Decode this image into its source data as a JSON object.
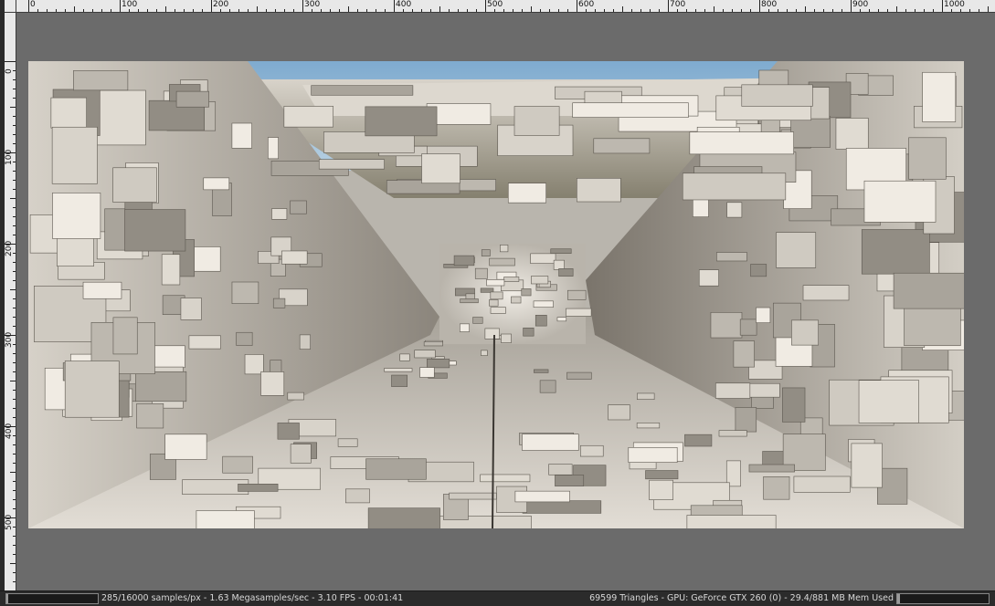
{
  "ruler": {
    "top_labels": [
      "0",
      "100",
      "200",
      "300",
      "400",
      "500",
      "600",
      "700",
      "800",
      "900",
      "1000"
    ],
    "left_labels": [
      "0",
      "100",
      "200",
      "300",
      "400",
      "500"
    ]
  },
  "status": {
    "left_text": "285/16000 samples/px - 1.63 Megasamples/sec - 3.10 FPS - 00:01:41",
    "right_text": "69599 Triangles - GPU: GeForce GTX 260 (0) - 29.4/881 MB Mem Used",
    "sample_progress": 0.0178,
    "memory_progress": 0.0334
  },
  "colors": {
    "sky": "#8fb6d4",
    "stone_light": "#d9d4cb",
    "stone_mid": "#b3aea5",
    "stone_dark": "#6f6a62",
    "background": "#6b6b6b"
  },
  "render": {
    "description_icon": "rendered-image"
  }
}
